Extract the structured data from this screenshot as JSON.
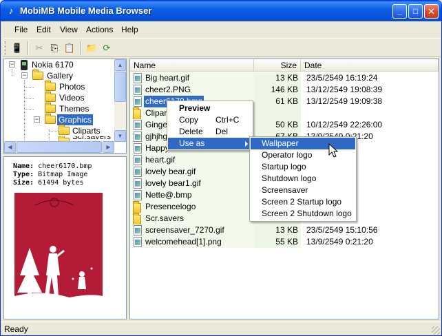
{
  "window": {
    "title": "MobiMB Mobile Media Browser"
  },
  "menubar": [
    "File",
    "Edit",
    "View",
    "Actions",
    "Help"
  ],
  "tree": {
    "root": "Nokia 6170",
    "nodes": [
      "Gallery",
      "Photos",
      "Videos",
      "Themes",
      "Graphics",
      "Cliparts",
      "Scr.savers"
    ]
  },
  "info": {
    "name_label": "Name:",
    "name_value": "cheer6170.bmp",
    "type_label": "Type:",
    "type_value": "Bitmap Image",
    "size_label": "Size:",
    "size_value": "61494 bytes"
  },
  "list": {
    "columns": [
      "Name",
      "Size",
      "Date"
    ],
    "rows": [
      {
        "name": "Big heart.gif",
        "size": "13 KB",
        "date": "23/5/2549 16:19:24"
      },
      {
        "name": "cheer2.PNG",
        "size": "146 KB",
        "date": "13/12/2549 19:08:39"
      },
      {
        "name": "cheer6170.bmp",
        "size": "61 KB",
        "date": "13/12/2549 19:09:38"
      },
      {
        "name": "Cliparts",
        "size": "",
        "date": ""
      },
      {
        "name": "Ginger",
        "size": "50 KB",
        "date": "10/12/2549 22:26:00"
      },
      {
        "name": "gjhjhg",
        "size": "67 KB",
        "date": "13/9/2549 0:21:20"
      },
      {
        "name": "Happy",
        "size": "",
        "date": "5:52"
      },
      {
        "name": "heart.gif",
        "size": "",
        "date": "7:52"
      },
      {
        "name": "lovely bear.gif",
        "size": "",
        "date": "8:50"
      },
      {
        "name": "lovely bear1.gif",
        "size": "",
        "date": "48"
      },
      {
        "name": "Nette@.bmp",
        "size": "",
        "date": ""
      },
      {
        "name": "Presencelogo",
        "size": "",
        "date": ""
      },
      {
        "name": "Scr.savers",
        "size": "",
        "date": ""
      },
      {
        "name": "screensaver_7270.gif",
        "size": "13 KB",
        "date": "23/5/2549 15:10:56"
      },
      {
        "name": "welcomehead[1].png",
        "size": "55 KB",
        "date": "13/9/2549 0:21:20"
      }
    ]
  },
  "context_menu": {
    "preview": "Preview",
    "copy": "Copy",
    "copy_shortcut": "Ctrl+C",
    "delete": "Delete",
    "delete_shortcut": "Del",
    "use_as": "Use as"
  },
  "submenu": [
    "Wallpaper",
    "Operator logo",
    "Startup logo",
    "Shutdown logo",
    "Screensaver",
    "Screen 2 Startup logo",
    "Screen 2 Shutdown logo"
  ],
  "status": {
    "text": "Ready"
  },
  "colors": {
    "selection": "#316ac5",
    "title_blue": "#0a5fe6",
    "preview_red": "#b31b37"
  }
}
